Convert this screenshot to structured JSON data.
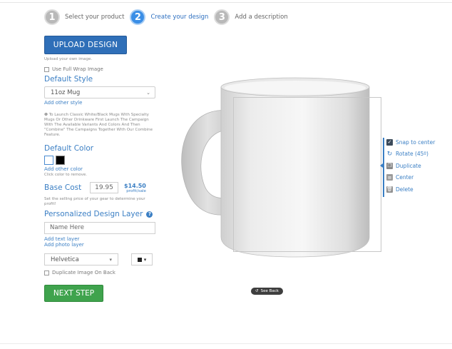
{
  "steps": [
    {
      "num": "1",
      "label": "Select your product"
    },
    {
      "num": "2",
      "label": "Create your design"
    },
    {
      "num": "3",
      "label": "Add a description"
    }
  ],
  "left": {
    "upload_label": "UPLOAD DESIGN",
    "upload_hint": "Upload your own image.",
    "full_wrap_label": "Use Full Wrap Image",
    "default_style_title": "Default Style",
    "style_value": "11oz Mug",
    "add_style_link": "Add other style",
    "info_text": "To Launch Classic White/Black Mugs With Specialty Mugs Or Other Drinkware First Launch The Campaign With The Available Variants And Colors And Then \"Combine\" The Campaigns Together With Our Combine Feature.",
    "default_color_title": "Default Color",
    "add_color_link": "Add other color",
    "color_hint": "Click color to remove.",
    "base_cost_label": "Base Cost",
    "base_cost_value": "19.95",
    "profit_value": "$14.50",
    "profit_label": "profit/sale",
    "selling_hint": "Set the selling price of your gear to determine your profit!",
    "pdl_title": "Personalized Design Layer",
    "name_placeholder": "Name Here",
    "add_text_link": "Add text layer",
    "add_photo_link": "Add photo layer",
    "font_value": "Helvetica",
    "duplicate_back_label": "Duplicate Image On Back",
    "next_label": "NEXT STEP"
  },
  "tools": [
    {
      "label": "Snap to center",
      "icon": "checkbox-checked-icon"
    },
    {
      "label": "Rotate (45º)",
      "icon": "rotate-icon"
    },
    {
      "label": "Duplicate",
      "icon": "duplicate-icon"
    },
    {
      "label": "Center",
      "icon": "center-icon"
    },
    {
      "label": "Delete",
      "icon": "trash-icon"
    }
  ],
  "see_back_label": "See Back",
  "colors": {
    "accent": "#3b7fc4",
    "upload": "#2f6fb8",
    "next": "#3fa34d",
    "swatch_white": "#ffffff",
    "swatch_black": "#000000"
  }
}
